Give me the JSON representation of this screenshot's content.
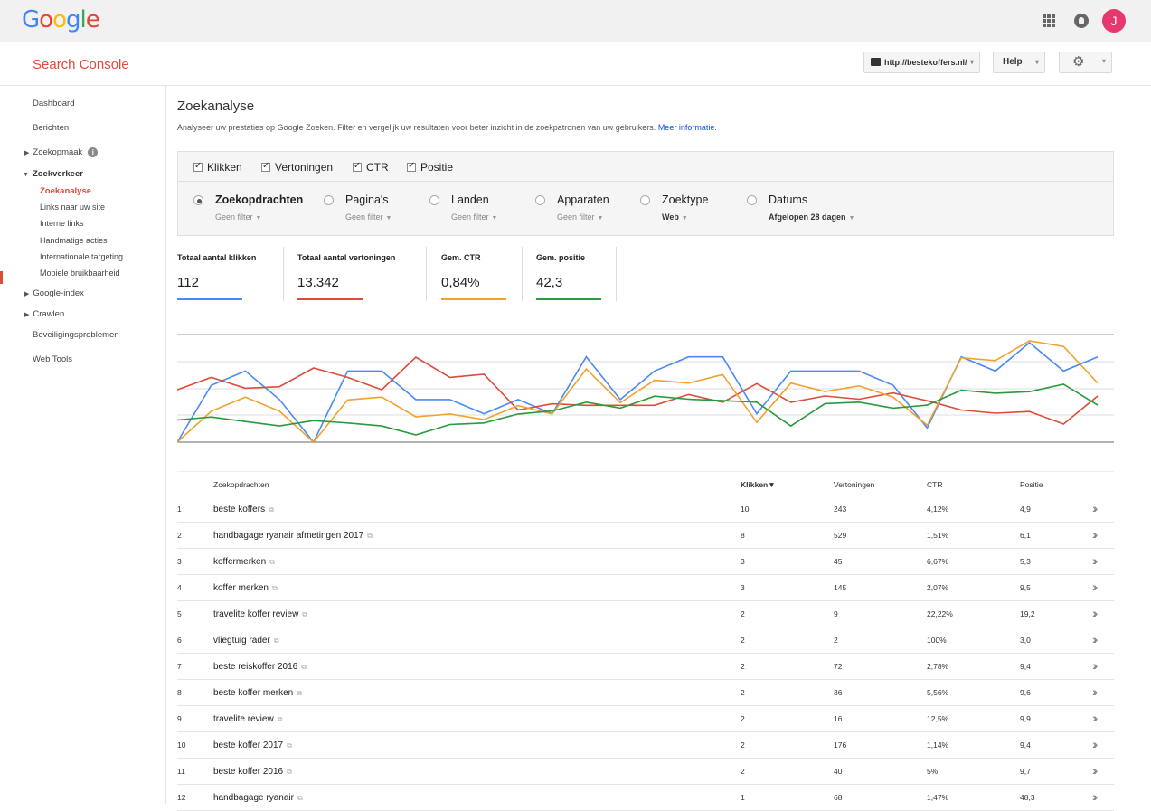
{
  "google": {
    "logo_letters": [
      "G",
      "o",
      "o",
      "g",
      "l",
      "e"
    ],
    "avatar_initial": "J"
  },
  "header": {
    "title": "Search Console",
    "site": "http://bestekoffers.nl/",
    "help": "Help"
  },
  "sidebar": {
    "items": [
      {
        "label": "Dashboard"
      },
      {
        "label": "Berichten"
      },
      {
        "label": "Zoekopmaak"
      },
      {
        "label": "Zoekverkeer"
      },
      {
        "label": "Zoekanalyse"
      },
      {
        "label": "Links naar uw site"
      },
      {
        "label": "Interne links"
      },
      {
        "label": "Handmatige acties"
      },
      {
        "label": "Internationale targeting"
      },
      {
        "label": "Mobiele bruikbaarheid"
      },
      {
        "label": "Google-index"
      },
      {
        "label": "Crawlen"
      },
      {
        "label": "Beveiligingsproblemen"
      },
      {
        "label": "Web Tools"
      }
    ]
  },
  "page": {
    "title": "Zoekanalyse",
    "description": "Analyseer uw prestaties op Google Zoeken. Filter en vergelijk uw resultaten voor beter inzicht in de zoekpatronen van uw gebruikers.",
    "more_link": "Meer informatie."
  },
  "metrics": {
    "klikken": "Klikken",
    "vertoningen": "Vertoningen",
    "ctr": "CTR",
    "positie": "Positie"
  },
  "dimensions": [
    {
      "label": "Zoekopdrachten",
      "sub": "Geen filter"
    },
    {
      "label": "Pagina's",
      "sub": "Geen filter"
    },
    {
      "label": "Landen",
      "sub": "Geen filter"
    },
    {
      "label": "Apparaten",
      "sub": "Geen filter"
    },
    {
      "label": "Zoektype",
      "sub": "Web"
    },
    {
      "label": "Datums",
      "sub": "Afgelopen 28 dagen"
    }
  ],
  "totals": [
    {
      "label": "Totaal aantal klikken",
      "value": "112",
      "color": "#4a8af4"
    },
    {
      "label": "Totaal aantal vertoningen",
      "value": "13.342",
      "color": "#dd4b39"
    },
    {
      "label": "Gem. CTR",
      "value": "0,84%",
      "color": "#f0a22e"
    },
    {
      "label": "Gem. positie",
      "value": "42,3",
      "color": "#2a9a3d"
    }
  ],
  "chart_data": {
    "type": "line",
    "series": [
      {
        "color": "#4a8af4",
        "values": [
          0,
          4,
          5,
          3,
          0,
          5,
          5,
          3,
          3,
          2,
          3,
          2,
          6,
          3,
          5,
          6,
          6,
          2,
          5,
          5,
          5,
          4,
          1,
          6,
          5,
          7,
          5,
          6
        ]
      },
      {
        "color": "#dd4b39",
        "values": [
          4.2,
          5.0,
          4.3,
          4.4,
          5.6,
          5.0,
          4.2,
          6.3,
          5.0,
          5.2,
          2.9,
          3.3,
          3.2,
          3.2,
          3.2,
          3.9,
          3.4,
          4.6,
          3.4,
          3.8,
          3.6,
          4.0,
          3.5,
          2.9,
          2.7,
          2.8,
          2.0,
          3.8
        ]
      },
      {
        "color": "#f0a22e",
        "values": [
          0,
          1.1,
          1.6,
          1.1,
          0,
          1.5,
          1.6,
          0.9,
          1.0,
          0.8,
          1.3,
          1.0,
          2.6,
          1.4,
          2.2,
          2.1,
          2.4,
          0.7,
          2.1,
          1.8,
          2.0,
          1.6,
          0.6,
          3.0,
          2.9,
          3.6,
          3.4,
          2.1
        ]
      },
      {
        "color": "#2a9a3d",
        "values": [
          42.0,
          43.0,
          41.5,
          40.0,
          41.8,
          41.0,
          40.0,
          37.0,
          40.5,
          41.0,
          44.0,
          45.0,
          48.0,
          46.0,
          50.0,
          49.0,
          48.5,
          48.0,
          40.0,
          47.5,
          48.0,
          46.0,
          47.0,
          52.0,
          51.0,
          51.5,
          54.0,
          47.0
        ]
      }
    ]
  },
  "table": {
    "headers": {
      "query": "Zoekopdrachten",
      "klikken": "Klikken▼",
      "vertoningen": "Vertoningen",
      "ctr": "CTR",
      "positie": "Positie"
    },
    "rows": [
      {
        "n": "1",
        "q": "beste koffers",
        "k": "10",
        "v": "243",
        "c": "4,12%",
        "p": "4,9"
      },
      {
        "n": "2",
        "q": "handbagage ryanair afmetingen 2017",
        "k": "8",
        "v": "529",
        "c": "1,51%",
        "p": "6,1"
      },
      {
        "n": "3",
        "q": "koffermerken",
        "k": "3",
        "v": "45",
        "c": "6,67%",
        "p": "5,3"
      },
      {
        "n": "4",
        "q": "koffer merken",
        "k": "3",
        "v": "145",
        "c": "2,07%",
        "p": "9,5"
      },
      {
        "n": "5",
        "q": "travelite koffer review",
        "k": "2",
        "v": "9",
        "c": "22,22%",
        "p": "19,2"
      },
      {
        "n": "6",
        "q": "vliegtuig rader",
        "k": "2",
        "v": "2",
        "c": "100%",
        "p": "3,0"
      },
      {
        "n": "7",
        "q": "beste reiskoffer 2016",
        "k": "2",
        "v": "72",
        "c": "2,78%",
        "p": "9,4"
      },
      {
        "n": "8",
        "q": "beste koffer merken",
        "k": "2",
        "v": "36",
        "c": "5,56%",
        "p": "9,6"
      },
      {
        "n": "9",
        "q": "travelite review",
        "k": "2",
        "v": "16",
        "c": "12,5%",
        "p": "9,9"
      },
      {
        "n": "10",
        "q": "beste koffer 2017",
        "k": "2",
        "v": "176",
        "c": "1,14%",
        "p": "9,4"
      },
      {
        "n": "11",
        "q": "beste koffer 2016",
        "k": "2",
        "v": "40",
        "c": "5%",
        "p": "9,7"
      },
      {
        "n": "12",
        "q": "handbagage ryanair",
        "k": "1",
        "v": "68",
        "c": "1,47%",
        "p": "48,3"
      }
    ]
  }
}
